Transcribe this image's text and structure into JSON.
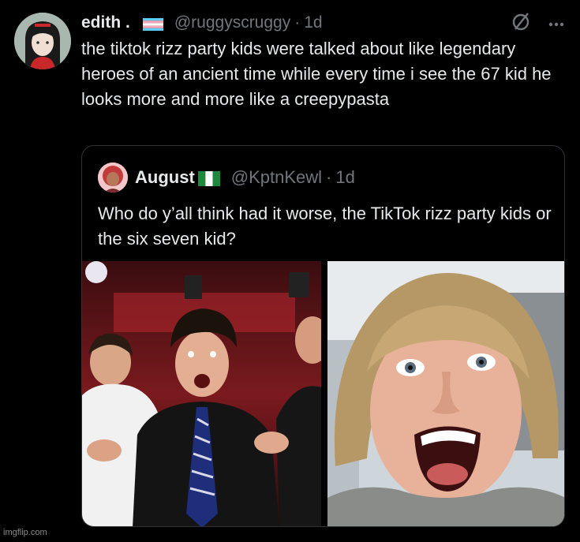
{
  "tweet": {
    "author_name": "edith .",
    "handle": "@ruggyscruggy",
    "separator": "·",
    "time": "1d",
    "text": "the tiktok rizz party kids were talked about like legendary heroes of an ancient time while every time i see the 67 kid he looks more and more like a creepypasta"
  },
  "quoted_tweet": {
    "author_name": "August",
    "handle": "@KptnKewl",
    "separator": "·",
    "time": "1d",
    "text": "Who do y’all think had it worse, the TikTok rizz party kids or the six seven kid?"
  },
  "icons": {
    "author_avatar": "profile-avatar",
    "trans_flag": "trans-flag-emoji",
    "grok_icon": "slash-circle-icon",
    "more_icon": "more-dots-icon",
    "quoted_avatar": "profile-avatar",
    "nigeria_flag": "nigeria-flag-emoji"
  },
  "images": [
    {
      "description": "party-photo"
    },
    {
      "description": "boy-closeup-photo"
    }
  ],
  "watermark": "imgflip.com",
  "colors": {
    "background": "#000000",
    "text": "#e7e9ea",
    "secondary": "#71767b",
    "border": "#2f3336"
  }
}
